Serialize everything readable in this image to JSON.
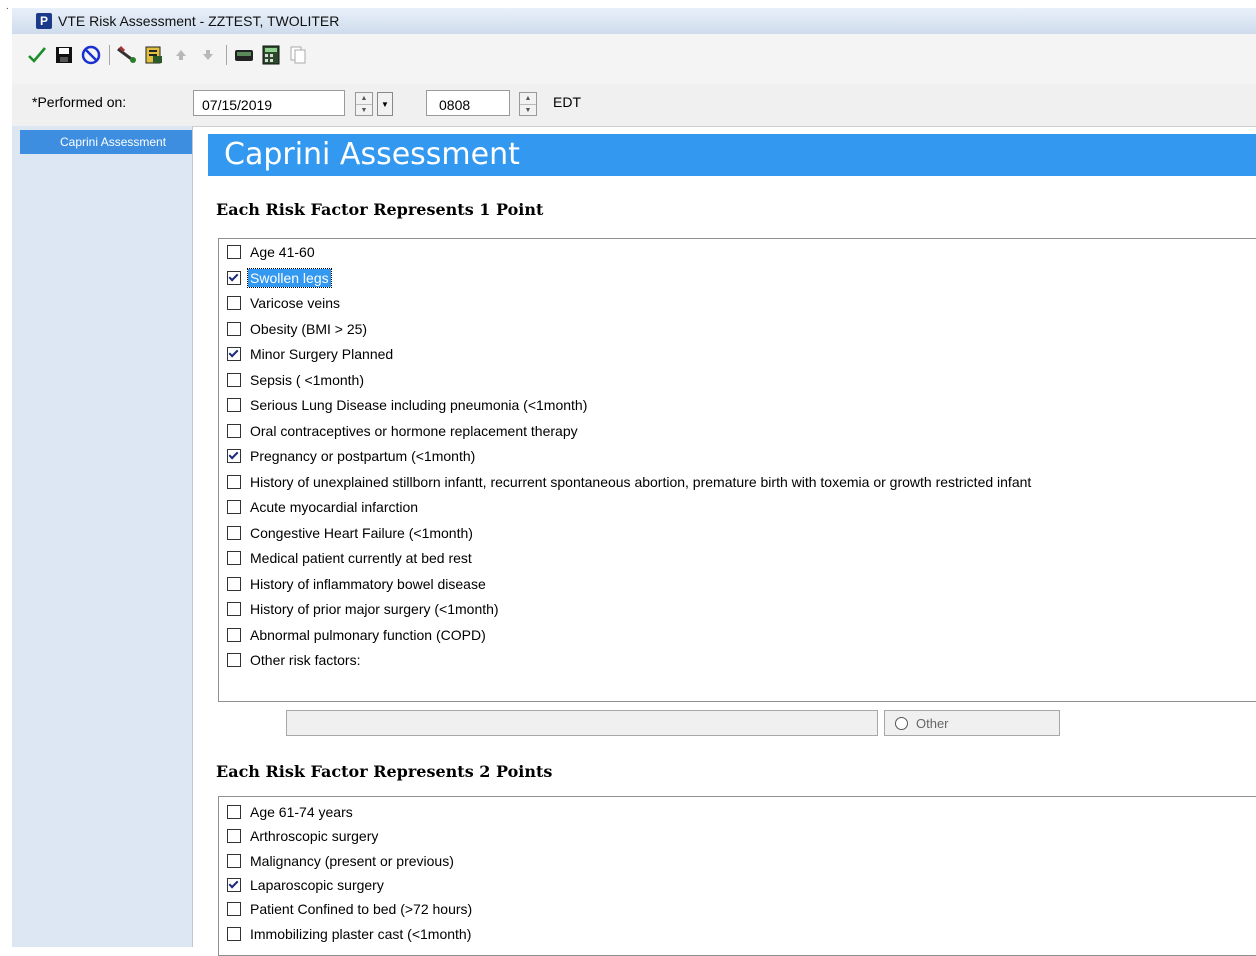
{
  "window": {
    "app_icon_letter": "P",
    "title": "VTE Risk Assessment - ZZTEST, TWOLITER"
  },
  "toolbar": {
    "buttons": [
      {
        "name": "sign-icon",
        "color": "#1a8f2a"
      },
      {
        "name": "save-icon"
      },
      {
        "name": "cancel-icon",
        "color": "#1a2fd0"
      },
      {
        "name": "tools-icon"
      },
      {
        "name": "form-browser-icon"
      },
      {
        "name": "arrow-up-icon"
      },
      {
        "name": "arrow-down-icon"
      },
      {
        "name": "keyboard-icon"
      },
      {
        "name": "calculator-icon"
      },
      {
        "name": "copy-icon"
      }
    ]
  },
  "performed": {
    "label": "*Performed on:",
    "date": "07/15/2019",
    "time": "0808",
    "timezone": "EDT"
  },
  "sidebar": {
    "items": [
      {
        "label": "Caprini Assessment",
        "selected": true
      }
    ]
  },
  "section": {
    "title": "Caprini Assessment"
  },
  "group1": {
    "title": "Each Risk Factor Represents 1 Point",
    "items": [
      {
        "label": "Age 41-60",
        "checked": false,
        "selected": false
      },
      {
        "label": "Swollen legs",
        "checked": true,
        "selected": true
      },
      {
        "label": "Varicose veins",
        "checked": false,
        "selected": false
      },
      {
        "label": "Obesity (BMI > 25)",
        "checked": false,
        "selected": false
      },
      {
        "label": "Minor Surgery Planned",
        "checked": true,
        "selected": false
      },
      {
        "label": "Sepsis ( <1month)",
        "checked": false,
        "selected": false
      },
      {
        "label": "Serious Lung Disease including pneumonia (<1month)",
        "checked": false,
        "selected": false
      },
      {
        "label": "Oral contraceptives or hormone replacement therapy",
        "checked": false,
        "selected": false
      },
      {
        "label": "Pregnancy or postpartum (<1month)",
        "checked": true,
        "selected": false
      },
      {
        "label": "History of unexplained stillborn infantt, recurrent spontaneous abortion, premature birth with toxemia or growth restricted infant",
        "checked": false,
        "selected": false
      },
      {
        "label": "Acute myocardial infarction",
        "checked": false,
        "selected": false
      },
      {
        "label": "Congestive Heart Failure (<1month)",
        "checked": false,
        "selected": false
      },
      {
        "label": "Medical patient currently at bed rest",
        "checked": false,
        "selected": false
      },
      {
        "label": "History of inflammatory bowel disease",
        "checked": false,
        "selected": false
      },
      {
        "label": "History of prior major surgery (<1month)",
        "checked": false,
        "selected": false
      },
      {
        "label": "Abnormal pulmonary function (COPD)",
        "checked": false,
        "selected": false
      },
      {
        "label": "Other risk factors:",
        "checked": false,
        "selected": false
      }
    ],
    "other": {
      "value": "",
      "radio_label": "Other"
    }
  },
  "group2": {
    "title": "Each Risk Factor Represents 2 Points",
    "items": [
      {
        "label": "Age 61-74 years",
        "checked": false
      },
      {
        "label": "Arthroscopic surgery",
        "checked": false
      },
      {
        "label": "Malignancy (present or previous)",
        "checked": false
      },
      {
        "label": "Laparoscopic surgery",
        "checked": true
      },
      {
        "label": "Patient Confined to bed (>72 hours)",
        "checked": false
      },
      {
        "label": "Immobilizing plaster cast (<1month)",
        "checked": false
      }
    ]
  }
}
